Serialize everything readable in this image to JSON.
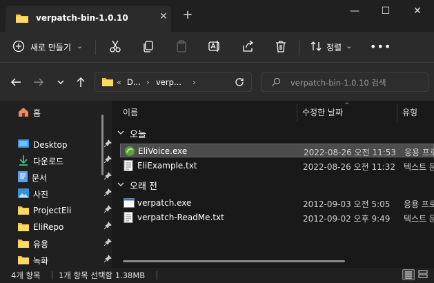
{
  "window": {
    "tab_title": "verpatch-bin-1.0.10",
    "new_tab_symbol": "+",
    "close_tab_symbol": "✕",
    "minimize_symbol": "—",
    "maximize_symbol": "☐",
    "close_symbol": "✕"
  },
  "toolbar": {
    "new_label": "새로 만들기",
    "new_chevron": "⌄",
    "sort_label": "정렬",
    "sort_chevron": "⌄",
    "more_label": "•••"
  },
  "address": {
    "overflow": "«",
    "segments": [
      "D...",
      "verp..."
    ],
    "separator": "›",
    "search_placeholder": "verpatch-bin-1.0.10 검색"
  },
  "sidebar": {
    "home_label": "홈",
    "items": [
      {
        "label": "Desktop",
        "icon": "desktop-icon",
        "pinned": true
      },
      {
        "label": "다운로드",
        "icon": "download-icon",
        "pinned": true
      },
      {
        "label": "문서",
        "icon": "document-icon",
        "pinned": true
      },
      {
        "label": "사진",
        "icon": "picture-icon",
        "pinned": true
      },
      {
        "label": "ProjectEli",
        "icon": "folder-icon",
        "pinned": true
      },
      {
        "label": "EliRepo",
        "icon": "folder-icon",
        "pinned": true
      },
      {
        "label": "유용",
        "icon": "folder-icon",
        "pinned": true
      },
      {
        "label": "녹화",
        "icon": "folder-icon",
        "pinned": true
      }
    ]
  },
  "columns": {
    "name": "이름",
    "modified": "수정한 날짜",
    "type": "유형"
  },
  "groups": [
    {
      "label": "오늘",
      "files": [
        {
          "name": "EliVoice.exe",
          "modified": "2022-08-26 오전 11:53",
          "type": "응용 프로그램",
          "icon": "app-icon",
          "selected": true
        },
        {
          "name": "EliExample.txt",
          "modified": "2022-08-26 오전 11:32",
          "type": "텍스트 문서",
          "icon": "text-file-icon",
          "selected": false
        }
      ]
    },
    {
      "label": "오래 전",
      "files": [
        {
          "name": "verpatch.exe",
          "modified": "2012-09-03 오전 5:05",
          "type": "응용 프로그램",
          "icon": "exe-icon",
          "selected": false
        },
        {
          "name": "verpatch-ReadMe.txt",
          "modified": "2012-09-02 오후 9:49",
          "type": "텍스트 문서",
          "icon": "text-file-icon",
          "selected": false
        }
      ]
    }
  ],
  "status": {
    "item_count": "4개 항목",
    "selection": "1개 항목 선택함 1.38MB"
  },
  "colors": {
    "background": "#202020",
    "panel": "#2b2b2b",
    "selection": "#4c4c4c",
    "folder": "#f6c343",
    "accent": "#4cc2ff"
  }
}
